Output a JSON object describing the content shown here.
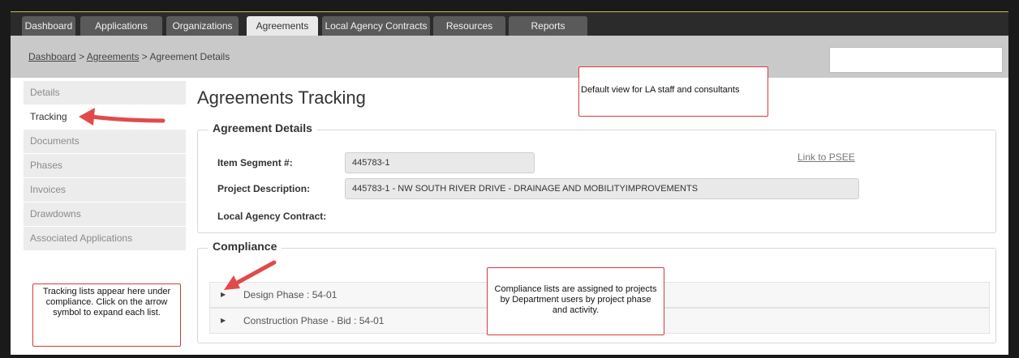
{
  "nav": {
    "tabs": [
      {
        "label": "Dashboard",
        "active": false
      },
      {
        "label": "Applications",
        "active": false
      },
      {
        "label": "Organizations",
        "active": false
      },
      {
        "label": "Agreements",
        "active": true
      },
      {
        "label": "Local Agency Contracts",
        "active": false
      },
      {
        "label": "Resources",
        "active": false
      },
      {
        "label": "Reports",
        "active": false
      }
    ]
  },
  "breadcrumb": {
    "items": [
      "Dashboard",
      "Agreements"
    ],
    "separator": ">",
    "current": "Agreement Details"
  },
  "sidebar": {
    "items": [
      {
        "label": "Details",
        "active": false
      },
      {
        "label": "Tracking",
        "active": true
      },
      {
        "label": "Documents",
        "active": false
      },
      {
        "label": "Phases",
        "active": false
      },
      {
        "label": "Invoices",
        "active": false
      },
      {
        "label": "Drawdowns",
        "active": false
      },
      {
        "label": "Associated Applications",
        "active": false
      }
    ]
  },
  "main": {
    "title": "Agreements Tracking",
    "details": {
      "legend": "Agreement Details",
      "item_segment_label": "Item Segment #:",
      "item_segment_value": "445783-1",
      "project_description_label": "Project Description:",
      "project_description_value": "445783-1 - NW SOUTH RIVER DRIVE - DRAINAGE AND MOBILITYIMPROVEMENTS",
      "local_agency_contract_label": "Local Agency Contract:",
      "link_psee": "Link to PSEE"
    },
    "compliance": {
      "legend": "Compliance",
      "rows": [
        {
          "label": "Design Phase : 54-01"
        },
        {
          "label": "Construction Phase - Bid : 54-01"
        }
      ]
    }
  },
  "callouts": {
    "default_view": "Default view for LA staff and consultants",
    "tracking_lists": "Tracking lists appear here under compliance. Click on the arrow symbol to expand each list.",
    "compliance_lists": "Compliance lists are assigned to projects by Department users by project phase and activity."
  },
  "colors": {
    "nav_bg": "#2b2b2b",
    "tab_bg": "#5a5a5a",
    "active_tab_bg": "#e9e9e9",
    "breadcrumb_bg": "#c9c9c9",
    "callout_border": "#d63a3a",
    "arrow": "#e24a4a"
  },
  "icons": {
    "expand": "caret-right-icon",
    "pointer": "red-arrow-icon"
  }
}
